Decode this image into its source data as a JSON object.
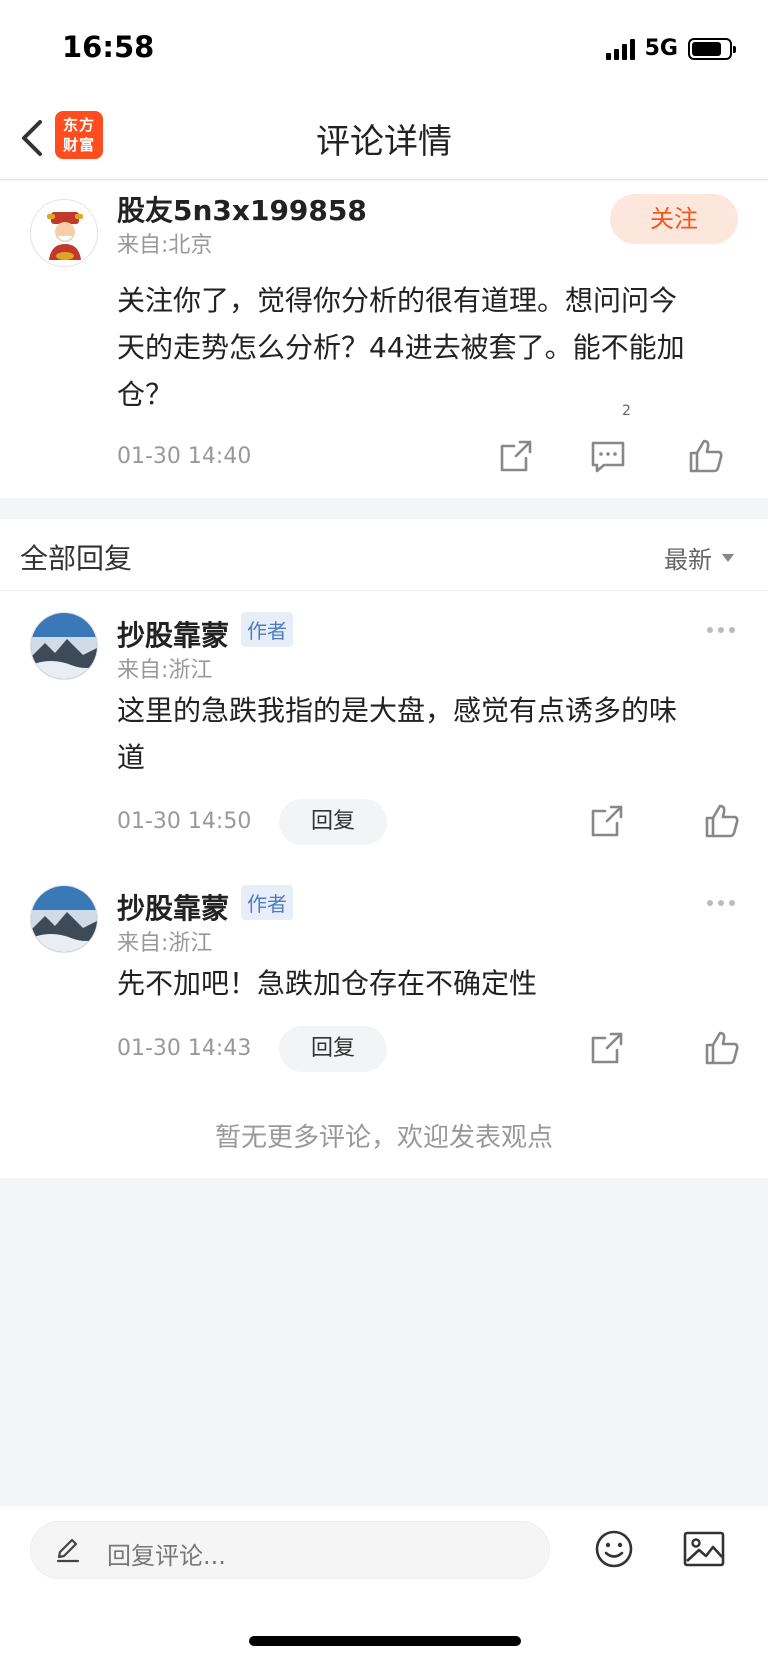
{
  "status_bar": {
    "time": "16:58",
    "network": "5G"
  },
  "nav": {
    "logo_line1": "东方",
    "logo_line2": "财富",
    "title": "评论详情"
  },
  "main_comment": {
    "username": "股友5n3x199858",
    "location": "来自:北京",
    "follow_label": "关注",
    "text_lines": [
      "关注你了，觉得你分析的很有道理。想问问今",
      "天的走势怎么分析？44进去被套了。能不能加",
      "仓？"
    ],
    "time": "01-30 14:40",
    "comment_count": "2"
  },
  "replies_header": {
    "title": "全部回复",
    "sort": "最新"
  },
  "replies": [
    {
      "username": "抄股靠蒙",
      "tag": "作者",
      "location": "来自:浙江",
      "text_lines": [
        "这里的急跌我指的是大盘，感觉有点诱多的味",
        "道"
      ],
      "time": "01-30 14:50",
      "reply_label": "回复"
    },
    {
      "username": "抄股靠蒙",
      "tag": "作者",
      "location": "来自:浙江",
      "text_lines": [
        "先不加吧！急跌加仓存在不确定性"
      ],
      "time": "01-30 14:43",
      "reply_label": "回复"
    }
  ],
  "no_more_text": "暂无更多评论，欢迎发表观点",
  "bottom_bar": {
    "placeholder": "回复评论..."
  },
  "colors": {
    "accent": "#f5561a",
    "logo_bg": "#ff4d1f",
    "author_tag": "#4f7bc4",
    "page_bg": "#f4f5f7"
  }
}
